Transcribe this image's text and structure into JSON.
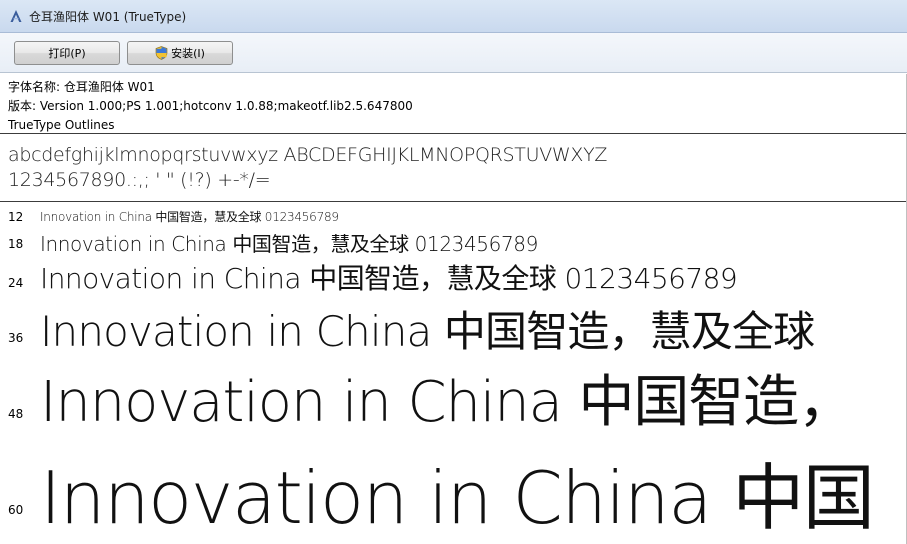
{
  "window": {
    "title": "仓耳渔阳体 W01 (TrueType)"
  },
  "toolbar": {
    "print_label": "打印(P)",
    "install_label": "安装(I)"
  },
  "info": {
    "font_name_line": "字体名称: 仓耳渔阳体 W01",
    "version_line": "版本: Version 1.000;PS 1.001;hotconv 1.0.88;makeotf.lib2.5.647800",
    "outline_line": "TrueType Outlines"
  },
  "charset": {
    "line1": "abcdefghijklmnopqrstuvwxyz ABCDEFGHIJKLMNOPQRSTUVWXYZ",
    "line2": "1234567890.:,; ' \" (!?) +-*/="
  },
  "samples": [
    {
      "size": "12",
      "text": "Innovation in China 中国智造，慧及全球 0123456789"
    },
    {
      "size": "18",
      "text": "Innovation in China 中国智造，慧及全球 0123456789"
    },
    {
      "size": "24",
      "text": "Innovation in China 中国智造，慧及全球 0123456789"
    },
    {
      "size": "36",
      "text": "Innovation in China 中国智造，慧及全球"
    },
    {
      "size": "48",
      "text": "Innovation in China 中国智造，"
    },
    {
      "size": "60",
      "text": "Innovation in China 中国"
    }
  ]
}
